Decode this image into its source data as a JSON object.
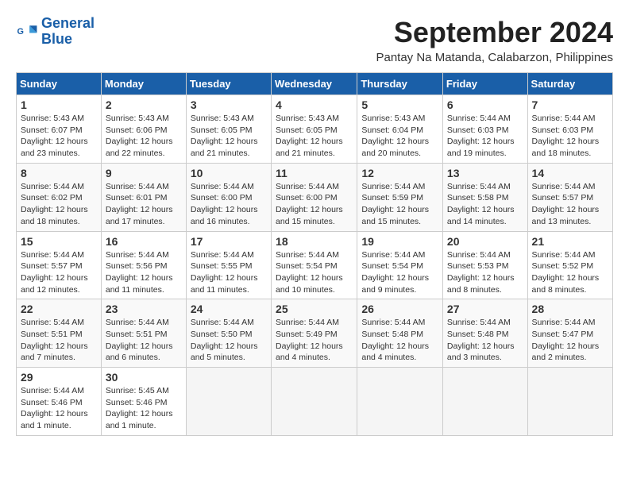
{
  "logo": {
    "text_general": "General",
    "text_blue": "Blue"
  },
  "header": {
    "month": "September 2024",
    "location": "Pantay Na Matanda, Calabarzon, Philippines"
  },
  "days_of_week": [
    "Sunday",
    "Monday",
    "Tuesday",
    "Wednesday",
    "Thursday",
    "Friday",
    "Saturday"
  ],
  "weeks": [
    [
      {
        "day": "1",
        "info": "Sunrise: 5:43 AM\nSunset: 6:07 PM\nDaylight: 12 hours\nand 23 minutes."
      },
      {
        "day": "2",
        "info": "Sunrise: 5:43 AM\nSunset: 6:06 PM\nDaylight: 12 hours\nand 22 minutes."
      },
      {
        "day": "3",
        "info": "Sunrise: 5:43 AM\nSunset: 6:05 PM\nDaylight: 12 hours\nand 21 minutes."
      },
      {
        "day": "4",
        "info": "Sunrise: 5:43 AM\nSunset: 6:05 PM\nDaylight: 12 hours\nand 21 minutes."
      },
      {
        "day": "5",
        "info": "Sunrise: 5:43 AM\nSunset: 6:04 PM\nDaylight: 12 hours\nand 20 minutes."
      },
      {
        "day": "6",
        "info": "Sunrise: 5:44 AM\nSunset: 6:03 PM\nDaylight: 12 hours\nand 19 minutes."
      },
      {
        "day": "7",
        "info": "Sunrise: 5:44 AM\nSunset: 6:03 PM\nDaylight: 12 hours\nand 18 minutes."
      }
    ],
    [
      {
        "day": "8",
        "info": "Sunrise: 5:44 AM\nSunset: 6:02 PM\nDaylight: 12 hours\nand 18 minutes."
      },
      {
        "day": "9",
        "info": "Sunrise: 5:44 AM\nSunset: 6:01 PM\nDaylight: 12 hours\nand 17 minutes."
      },
      {
        "day": "10",
        "info": "Sunrise: 5:44 AM\nSunset: 6:00 PM\nDaylight: 12 hours\nand 16 minutes."
      },
      {
        "day": "11",
        "info": "Sunrise: 5:44 AM\nSunset: 6:00 PM\nDaylight: 12 hours\nand 15 minutes."
      },
      {
        "day": "12",
        "info": "Sunrise: 5:44 AM\nSunset: 5:59 PM\nDaylight: 12 hours\nand 15 minutes."
      },
      {
        "day": "13",
        "info": "Sunrise: 5:44 AM\nSunset: 5:58 PM\nDaylight: 12 hours\nand 14 minutes."
      },
      {
        "day": "14",
        "info": "Sunrise: 5:44 AM\nSunset: 5:57 PM\nDaylight: 12 hours\nand 13 minutes."
      }
    ],
    [
      {
        "day": "15",
        "info": "Sunrise: 5:44 AM\nSunset: 5:57 PM\nDaylight: 12 hours\nand 12 minutes."
      },
      {
        "day": "16",
        "info": "Sunrise: 5:44 AM\nSunset: 5:56 PM\nDaylight: 12 hours\nand 11 minutes."
      },
      {
        "day": "17",
        "info": "Sunrise: 5:44 AM\nSunset: 5:55 PM\nDaylight: 12 hours\nand 11 minutes."
      },
      {
        "day": "18",
        "info": "Sunrise: 5:44 AM\nSunset: 5:54 PM\nDaylight: 12 hours\nand 10 minutes."
      },
      {
        "day": "19",
        "info": "Sunrise: 5:44 AM\nSunset: 5:54 PM\nDaylight: 12 hours\nand 9 minutes."
      },
      {
        "day": "20",
        "info": "Sunrise: 5:44 AM\nSunset: 5:53 PM\nDaylight: 12 hours\nand 8 minutes."
      },
      {
        "day": "21",
        "info": "Sunrise: 5:44 AM\nSunset: 5:52 PM\nDaylight: 12 hours\nand 8 minutes."
      }
    ],
    [
      {
        "day": "22",
        "info": "Sunrise: 5:44 AM\nSunset: 5:51 PM\nDaylight: 12 hours\nand 7 minutes."
      },
      {
        "day": "23",
        "info": "Sunrise: 5:44 AM\nSunset: 5:51 PM\nDaylight: 12 hours\nand 6 minutes."
      },
      {
        "day": "24",
        "info": "Sunrise: 5:44 AM\nSunset: 5:50 PM\nDaylight: 12 hours\nand 5 minutes."
      },
      {
        "day": "25",
        "info": "Sunrise: 5:44 AM\nSunset: 5:49 PM\nDaylight: 12 hours\nand 4 minutes."
      },
      {
        "day": "26",
        "info": "Sunrise: 5:44 AM\nSunset: 5:48 PM\nDaylight: 12 hours\nand 4 minutes."
      },
      {
        "day": "27",
        "info": "Sunrise: 5:44 AM\nSunset: 5:48 PM\nDaylight: 12 hours\nand 3 minutes."
      },
      {
        "day": "28",
        "info": "Sunrise: 5:44 AM\nSunset: 5:47 PM\nDaylight: 12 hours\nand 2 minutes."
      }
    ],
    [
      {
        "day": "29",
        "info": "Sunrise: 5:44 AM\nSunset: 5:46 PM\nDaylight: 12 hours\nand 1 minute."
      },
      {
        "day": "30",
        "info": "Sunrise: 5:45 AM\nSunset: 5:46 PM\nDaylight: 12 hours\nand 1 minute."
      },
      null,
      null,
      null,
      null,
      null
    ]
  ]
}
